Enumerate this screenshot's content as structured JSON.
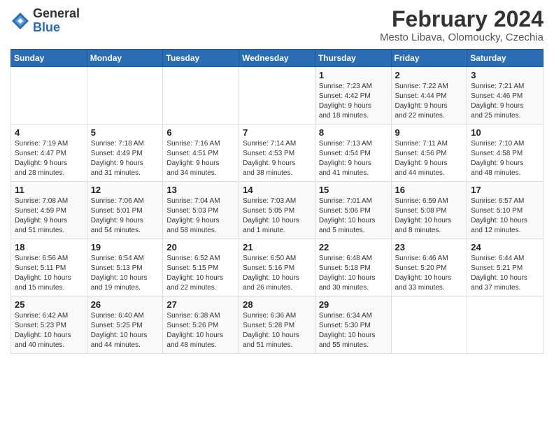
{
  "header": {
    "logo_general": "General",
    "logo_blue": "Blue",
    "main_title": "February 2024",
    "subtitle": "Mesto Libava, Olomoucky, Czechia"
  },
  "calendar": {
    "days_of_week": [
      "Sunday",
      "Monday",
      "Tuesday",
      "Wednesday",
      "Thursday",
      "Friday",
      "Saturday"
    ],
    "weeks": [
      [
        {
          "day": "",
          "info": ""
        },
        {
          "day": "",
          "info": ""
        },
        {
          "day": "",
          "info": ""
        },
        {
          "day": "",
          "info": ""
        },
        {
          "day": "1",
          "info": "Sunrise: 7:23 AM\nSunset: 4:42 PM\nDaylight: 9 hours\nand 18 minutes."
        },
        {
          "day": "2",
          "info": "Sunrise: 7:22 AM\nSunset: 4:44 PM\nDaylight: 9 hours\nand 22 minutes."
        },
        {
          "day": "3",
          "info": "Sunrise: 7:21 AM\nSunset: 4:46 PM\nDaylight: 9 hours\nand 25 minutes."
        }
      ],
      [
        {
          "day": "4",
          "info": "Sunrise: 7:19 AM\nSunset: 4:47 PM\nDaylight: 9 hours\nand 28 minutes."
        },
        {
          "day": "5",
          "info": "Sunrise: 7:18 AM\nSunset: 4:49 PM\nDaylight: 9 hours\nand 31 minutes."
        },
        {
          "day": "6",
          "info": "Sunrise: 7:16 AM\nSunset: 4:51 PM\nDaylight: 9 hours\nand 34 minutes."
        },
        {
          "day": "7",
          "info": "Sunrise: 7:14 AM\nSunset: 4:53 PM\nDaylight: 9 hours\nand 38 minutes."
        },
        {
          "day": "8",
          "info": "Sunrise: 7:13 AM\nSunset: 4:54 PM\nDaylight: 9 hours\nand 41 minutes."
        },
        {
          "day": "9",
          "info": "Sunrise: 7:11 AM\nSunset: 4:56 PM\nDaylight: 9 hours\nand 44 minutes."
        },
        {
          "day": "10",
          "info": "Sunrise: 7:10 AM\nSunset: 4:58 PM\nDaylight: 9 hours\nand 48 minutes."
        }
      ],
      [
        {
          "day": "11",
          "info": "Sunrise: 7:08 AM\nSunset: 4:59 PM\nDaylight: 9 hours\nand 51 minutes."
        },
        {
          "day": "12",
          "info": "Sunrise: 7:06 AM\nSunset: 5:01 PM\nDaylight: 9 hours\nand 54 minutes."
        },
        {
          "day": "13",
          "info": "Sunrise: 7:04 AM\nSunset: 5:03 PM\nDaylight: 9 hours\nand 58 minutes."
        },
        {
          "day": "14",
          "info": "Sunrise: 7:03 AM\nSunset: 5:05 PM\nDaylight: 10 hours\nand 1 minute."
        },
        {
          "day": "15",
          "info": "Sunrise: 7:01 AM\nSunset: 5:06 PM\nDaylight: 10 hours\nand 5 minutes."
        },
        {
          "day": "16",
          "info": "Sunrise: 6:59 AM\nSunset: 5:08 PM\nDaylight: 10 hours\nand 8 minutes."
        },
        {
          "day": "17",
          "info": "Sunrise: 6:57 AM\nSunset: 5:10 PM\nDaylight: 10 hours\nand 12 minutes."
        }
      ],
      [
        {
          "day": "18",
          "info": "Sunrise: 6:56 AM\nSunset: 5:11 PM\nDaylight: 10 hours\nand 15 minutes."
        },
        {
          "day": "19",
          "info": "Sunrise: 6:54 AM\nSunset: 5:13 PM\nDaylight: 10 hours\nand 19 minutes."
        },
        {
          "day": "20",
          "info": "Sunrise: 6:52 AM\nSunset: 5:15 PM\nDaylight: 10 hours\nand 22 minutes."
        },
        {
          "day": "21",
          "info": "Sunrise: 6:50 AM\nSunset: 5:16 PM\nDaylight: 10 hours\nand 26 minutes."
        },
        {
          "day": "22",
          "info": "Sunrise: 6:48 AM\nSunset: 5:18 PM\nDaylight: 10 hours\nand 30 minutes."
        },
        {
          "day": "23",
          "info": "Sunrise: 6:46 AM\nSunset: 5:20 PM\nDaylight: 10 hours\nand 33 minutes."
        },
        {
          "day": "24",
          "info": "Sunrise: 6:44 AM\nSunset: 5:21 PM\nDaylight: 10 hours\nand 37 minutes."
        }
      ],
      [
        {
          "day": "25",
          "info": "Sunrise: 6:42 AM\nSunset: 5:23 PM\nDaylight: 10 hours\nand 40 minutes."
        },
        {
          "day": "26",
          "info": "Sunrise: 6:40 AM\nSunset: 5:25 PM\nDaylight: 10 hours\nand 44 minutes."
        },
        {
          "day": "27",
          "info": "Sunrise: 6:38 AM\nSunset: 5:26 PM\nDaylight: 10 hours\nand 48 minutes."
        },
        {
          "day": "28",
          "info": "Sunrise: 6:36 AM\nSunset: 5:28 PM\nDaylight: 10 hours\nand 51 minutes."
        },
        {
          "day": "29",
          "info": "Sunrise: 6:34 AM\nSunset: 5:30 PM\nDaylight: 10 hours\nand 55 minutes."
        },
        {
          "day": "",
          "info": ""
        },
        {
          "day": "",
          "info": ""
        }
      ]
    ]
  }
}
